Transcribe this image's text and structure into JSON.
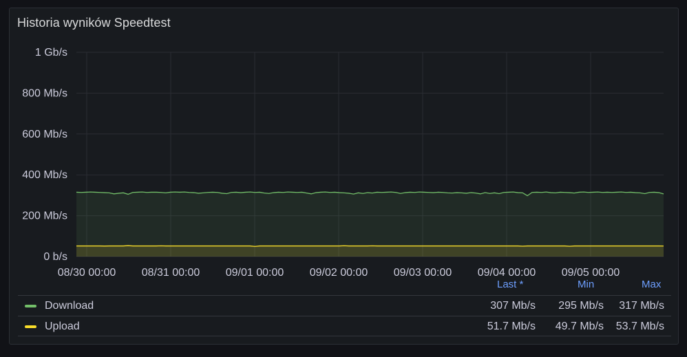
{
  "panel": {
    "title": "Historia wyników Speedtest"
  },
  "legend": {
    "headers": {
      "last": "Last *",
      "min": "Min",
      "max": "Max"
    },
    "rows": [
      {
        "name": "Download",
        "color": "#73bf69",
        "last": "307 Mb/s",
        "min": "295 Mb/s",
        "max": "317 Mb/s"
      },
      {
        "name": "Upload",
        "color": "#fade2a",
        "last": "51.7 Mb/s",
        "min": "49.7 Mb/s",
        "max": "53.7 Mb/s"
      }
    ]
  },
  "chart_data": {
    "type": "line",
    "ylim": [
      0,
      1000
    ],
    "y_ticks": [
      {
        "value": 0,
        "label": "0 b/s"
      },
      {
        "value": 200,
        "label": "200 Mb/s"
      },
      {
        "value": 400,
        "label": "400 Mb/s"
      },
      {
        "value": 600,
        "label": "600 Mb/s"
      },
      {
        "value": 800,
        "label": "800 Mb/s"
      },
      {
        "value": 1000,
        "label": "1 Gb/s"
      }
    ],
    "xlim": [
      "2023-08-30 00:00",
      "2023-09-05 23:59"
    ],
    "x_ticks": [
      "08/30 00:00",
      "08/31 00:00",
      "09/01 00:00",
      "09/02 00:00",
      "09/03 00:00",
      "09/04 00:00",
      "09/05 00:00"
    ],
    "grid": true,
    "legend_position": "bottom",
    "series": [
      {
        "name": "Download",
        "color": "#73bf69",
        "fill": true,
        "values": [
          315,
          314,
          315,
          316,
          315,
          314,
          313,
          312,
          307,
          310,
          312,
          305,
          314,
          315,
          316,
          314,
          315,
          315,
          314,
          312,
          315,
          316,
          315,
          316,
          314,
          313,
          310,
          312,
          314,
          315,
          314,
          310,
          308,
          314,
          315,
          313,
          315,
          316,
          314,
          315,
          311,
          309,
          313,
          315,
          314,
          316,
          315,
          314,
          315,
          311,
          307,
          313,
          315,
          316,
          314,
          315,
          313,
          312,
          310,
          306,
          312,
          309,
          313,
          311,
          315,
          314,
          315,
          316,
          314,
          309,
          313,
          315,
          314,
          316,
          315,
          314,
          313,
          315,
          314,
          312,
          311,
          313,
          312,
          310,
          313,
          311,
          307,
          313,
          309,
          312,
          308,
          314,
          315,
          316,
          313,
          312,
          298,
          314,
          315,
          314,
          316,
          313,
          312,
          315,
          314,
          313,
          311,
          315,
          316,
          314,
          315,
          316,
          314,
          315,
          314,
          315,
          316,
          314,
          315,
          313,
          312,
          308,
          314,
          315,
          313,
          307
        ]
      },
      {
        "name": "Upload",
        "color": "#fade2a",
        "fill": true,
        "values": [
          52,
          52,
          52,
          52,
          52,
          52,
          51.5,
          52,
          52,
          52,
          52,
          53.7,
          52,
          52,
          52,
          52,
          52,
          52,
          52.5,
          52,
          52,
          52,
          52,
          52,
          52,
          52,
          52,
          52,
          52,
          52,
          52,
          52,
          52,
          52,
          52,
          52,
          52,
          52,
          49.7,
          52,
          52,
          52,
          52,
          52,
          52,
          52,
          52,
          52,
          52,
          52,
          52,
          52,
          52,
          52,
          52,
          52,
          52,
          53,
          52,
          52,
          52,
          52,
          52,
          52.5,
          52,
          52,
          52,
          52,
          52,
          52,
          52,
          52,
          52,
          52,
          52,
          52,
          52,
          52,
          52,
          52,
          52,
          52,
          52,
          52,
          52,
          52,
          52,
          52,
          52,
          52,
          52,
          52,
          52,
          52,
          52,
          51,
          52,
          52,
          52,
          52,
          52,
          52,
          52,
          52,
          52,
          50.5,
          52,
          52,
          52,
          52,
          52,
          52,
          52,
          52,
          52,
          52,
          52,
          52,
          52,
          52,
          52,
          52,
          52,
          52,
          52,
          51.7
        ]
      }
    ]
  }
}
